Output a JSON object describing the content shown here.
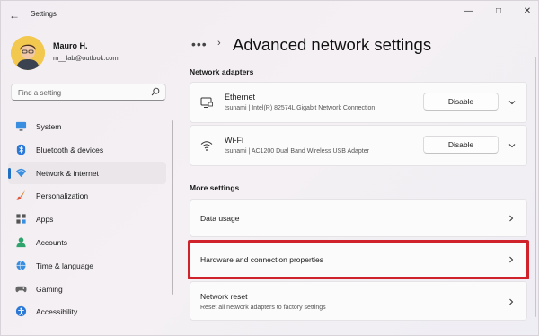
{
  "window": {
    "back_glyph": "←",
    "title": "Settings",
    "minimize_glyph": "—",
    "maximize_glyph": "□",
    "close_glyph": "✕"
  },
  "profile": {
    "name": "Mauro H.",
    "email": "m__lab@outlook.com"
  },
  "search": {
    "placeholder": "Find a setting"
  },
  "sidebar": {
    "items": [
      {
        "label": "System",
        "icon": "monitor-icon"
      },
      {
        "label": "Bluetooth & devices",
        "icon": "bluetooth-icon"
      },
      {
        "label": "Network & internet",
        "icon": "wifi-diamond-icon",
        "active": true
      },
      {
        "label": "Personalization",
        "icon": "brush-icon"
      },
      {
        "label": "Apps",
        "icon": "apps-grid-icon"
      },
      {
        "label": "Accounts",
        "icon": "person-icon"
      },
      {
        "label": "Time & language",
        "icon": "globe-clock-icon"
      },
      {
        "label": "Gaming",
        "icon": "gamepad-icon"
      },
      {
        "label": "Accessibility",
        "icon": "accessibility-icon"
      }
    ]
  },
  "breadcrumb": {
    "more": "•••",
    "separator": "›"
  },
  "page": {
    "title": "Advanced network settings"
  },
  "network_adapters": {
    "heading": "Network adapters",
    "adapters": [
      {
        "name": "Ethernet",
        "description": "tsunami | Intel(R) 82574L Gigabit Network Connection",
        "button": "Disable",
        "icon": "ethernet-monitor-icon"
      },
      {
        "name": "Wi-Fi",
        "description": "tsunami | AC1200  Dual Band Wireless USB Adapter",
        "button": "Disable",
        "icon": "wifi-icon"
      }
    ]
  },
  "more_settings": {
    "heading": "More settings",
    "items": [
      {
        "label": "Data usage"
      },
      {
        "label": "Hardware and connection properties"
      },
      {
        "label": "Network reset",
        "description": "Reset all network adapters to factory settings"
      }
    ]
  },
  "colors": {
    "accent": "#1f6fc2",
    "highlight_border": "#d0222a",
    "background": "#f3eff2"
  }
}
